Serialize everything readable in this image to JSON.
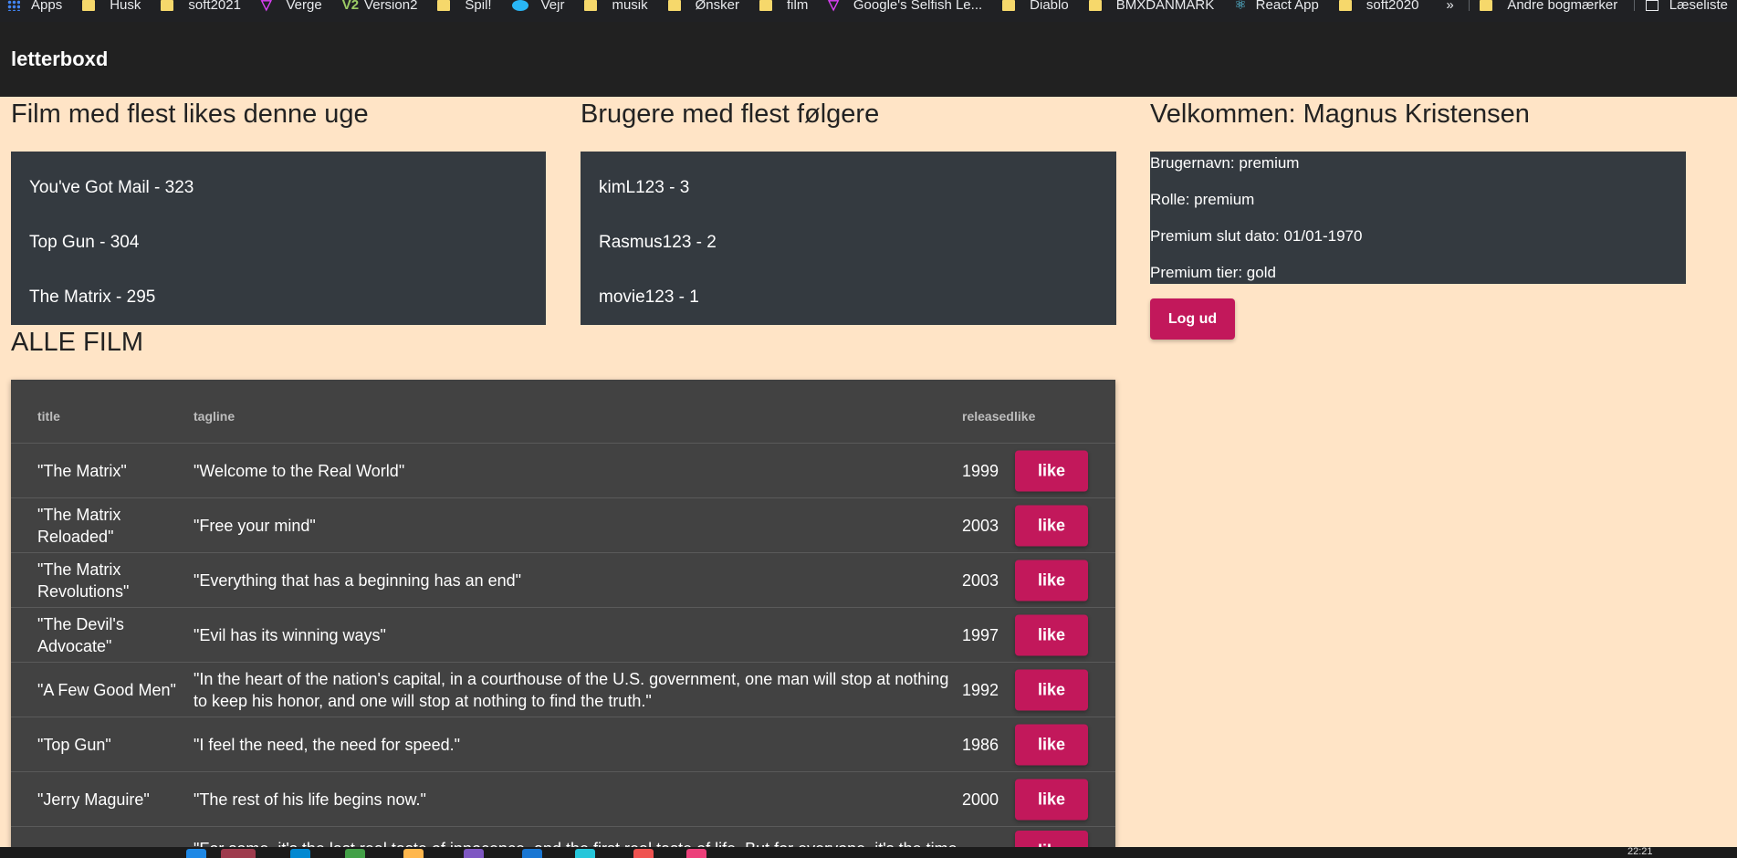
{
  "bookmarks": {
    "apps_label": "Apps",
    "items": [
      "Husk",
      "soft2021",
      "Verge",
      "Version2",
      "Spil!",
      "Vejr",
      "musik",
      "Ønsker",
      "film",
      "Google's Selfish Le...",
      "Diablo",
      "BMXDANMARK",
      "React App",
      "soft2020"
    ],
    "more": "»",
    "other": "Andre bogmærker",
    "reading_list": "Læseliste"
  },
  "header": {
    "brand": "letterboxd"
  },
  "top_films": {
    "heading": "Film med flest likes denne uge",
    "items": [
      "You've Got Mail - 323",
      "Top Gun - 304",
      "The Matrix - 295"
    ]
  },
  "top_users": {
    "heading": "Brugere med flest følgere",
    "items": [
      "kimL123 - 3",
      "Rasmus123 - 2",
      "movie123 - 1"
    ]
  },
  "welcome": {
    "heading": "Velkommen: Magnus Kristensen",
    "username": "Brugernavn: premium",
    "role": "Rolle: premium",
    "premium_end": "Premium slut dato: 01/01-1970",
    "premium_tier": "Premium tier: gold",
    "logout_label": "Log ud"
  },
  "all_films": {
    "heading": "ALLE FILM",
    "columns": {
      "title": "title",
      "tagline": "tagline",
      "released": "released",
      "like": "like"
    },
    "like_label": "like",
    "rows": [
      {
        "title": "\"The Matrix\"",
        "tagline": "\"Welcome to the Real World\"",
        "released": "1999"
      },
      {
        "title": "\"The Matrix Reloaded\"",
        "tagline": "\"Free your mind\"",
        "released": "2003"
      },
      {
        "title": "\"The Matrix Revolutions\"",
        "tagline": "\"Everything that has a beginning has an end\"",
        "released": "2003"
      },
      {
        "title": "\"The Devil's Advocate\"",
        "tagline": "\"Evil has its winning ways\"",
        "released": "1997"
      },
      {
        "title": "\"A Few Good Men\"",
        "tagline": "\"In the heart of the nation's capital, in a courthouse of the U.S. government, one man will stop at nothing to keep his honor, and one will stop at nothing to find the truth.\"",
        "released": "1992"
      },
      {
        "title": "\"Top Gun\"",
        "tagline": "\"I feel the need, the need for speed.\"",
        "released": "1986"
      },
      {
        "title": "\"Jerry Maguire\"",
        "tagline": "\"The rest of his life begins now.\"",
        "released": "2000"
      },
      {
        "title": "",
        "tagline": "\"For some, it's the last real taste of innocence, and the first real taste of life. But for everyone, it's the time",
        "released": ""
      }
    ]
  },
  "taskbar": {
    "clock": "22:21"
  },
  "colors": {
    "accent": "#c2185b",
    "page_bg": "#ffe4c6",
    "panel_bg": "#343a40",
    "table_bg": "#424242",
    "header_bg": "#212121"
  }
}
